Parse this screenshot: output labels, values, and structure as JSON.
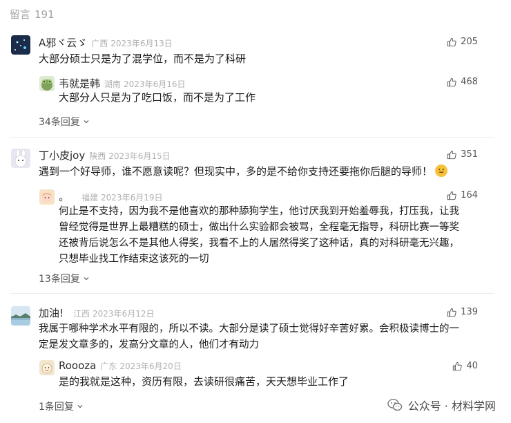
{
  "header": {
    "label": "留言",
    "count": "191"
  },
  "comments": [
    {
      "name": "A邪ヾ云ゞ",
      "location": "广西",
      "date": "2023年6月13日",
      "likes": "205",
      "text": "大部分硕士只是为了混学位，而不是为了科研",
      "reply": {
        "name": "韦就是韩",
        "location": "湖南",
        "date": "2023年6月16日",
        "likes": "468",
        "text": "大部分人只是为了吃口饭，而不是为了工作"
      },
      "more": "34条回复"
    },
    {
      "name": "丁小皮joy",
      "location": "陕西",
      "date": "2023年6月15日",
      "likes": "351",
      "text": "遇到一个好导师，谁不愿意读呢？但现实中，多的是不给你支持还要拖你后腿的导师！",
      "reply": {
        "name": "。",
        "location": "福建",
        "date": "2023年6月19日",
        "likes": "164",
        "text_lines": [
          "何止是不支持，因为我不是他喜欢的那种舔狗学生，他讨厌我到开始羞辱我，打压我，让我",
          "曾经觉得是世界上最糟糕的硕士，做出什么实验都会被骂，全程毫无指导，科研比赛一等奖",
          "还被背后说怎么不是其他人得奖，我看不上的人居然得奖了这种话，真的对科研毫无兴趣，",
          "只想毕业找工作结束这该死的一切"
        ]
      },
      "more": "13条回复"
    },
    {
      "name": "加油!",
      "location": "江西",
      "date": "2023年6月12日",
      "likes": "139",
      "text_lines": [
        "我属于哪种学术水平有限的，所以不读。大部分是读了硕士觉得好辛苦好累。会积极读博士的一",
        "定是发文章多的，发高分文章的人，他们才有动力"
      ],
      "reply": {
        "name": "Roooza",
        "location": "广东",
        "date": "2023年6月20日",
        "likes": "40",
        "text": "是的我就是这种，资历有限，去读研很痛苦，天天想毕业工作了"
      },
      "more": "1条回复"
    }
  ],
  "watermark": "公众号 · 材料学网"
}
